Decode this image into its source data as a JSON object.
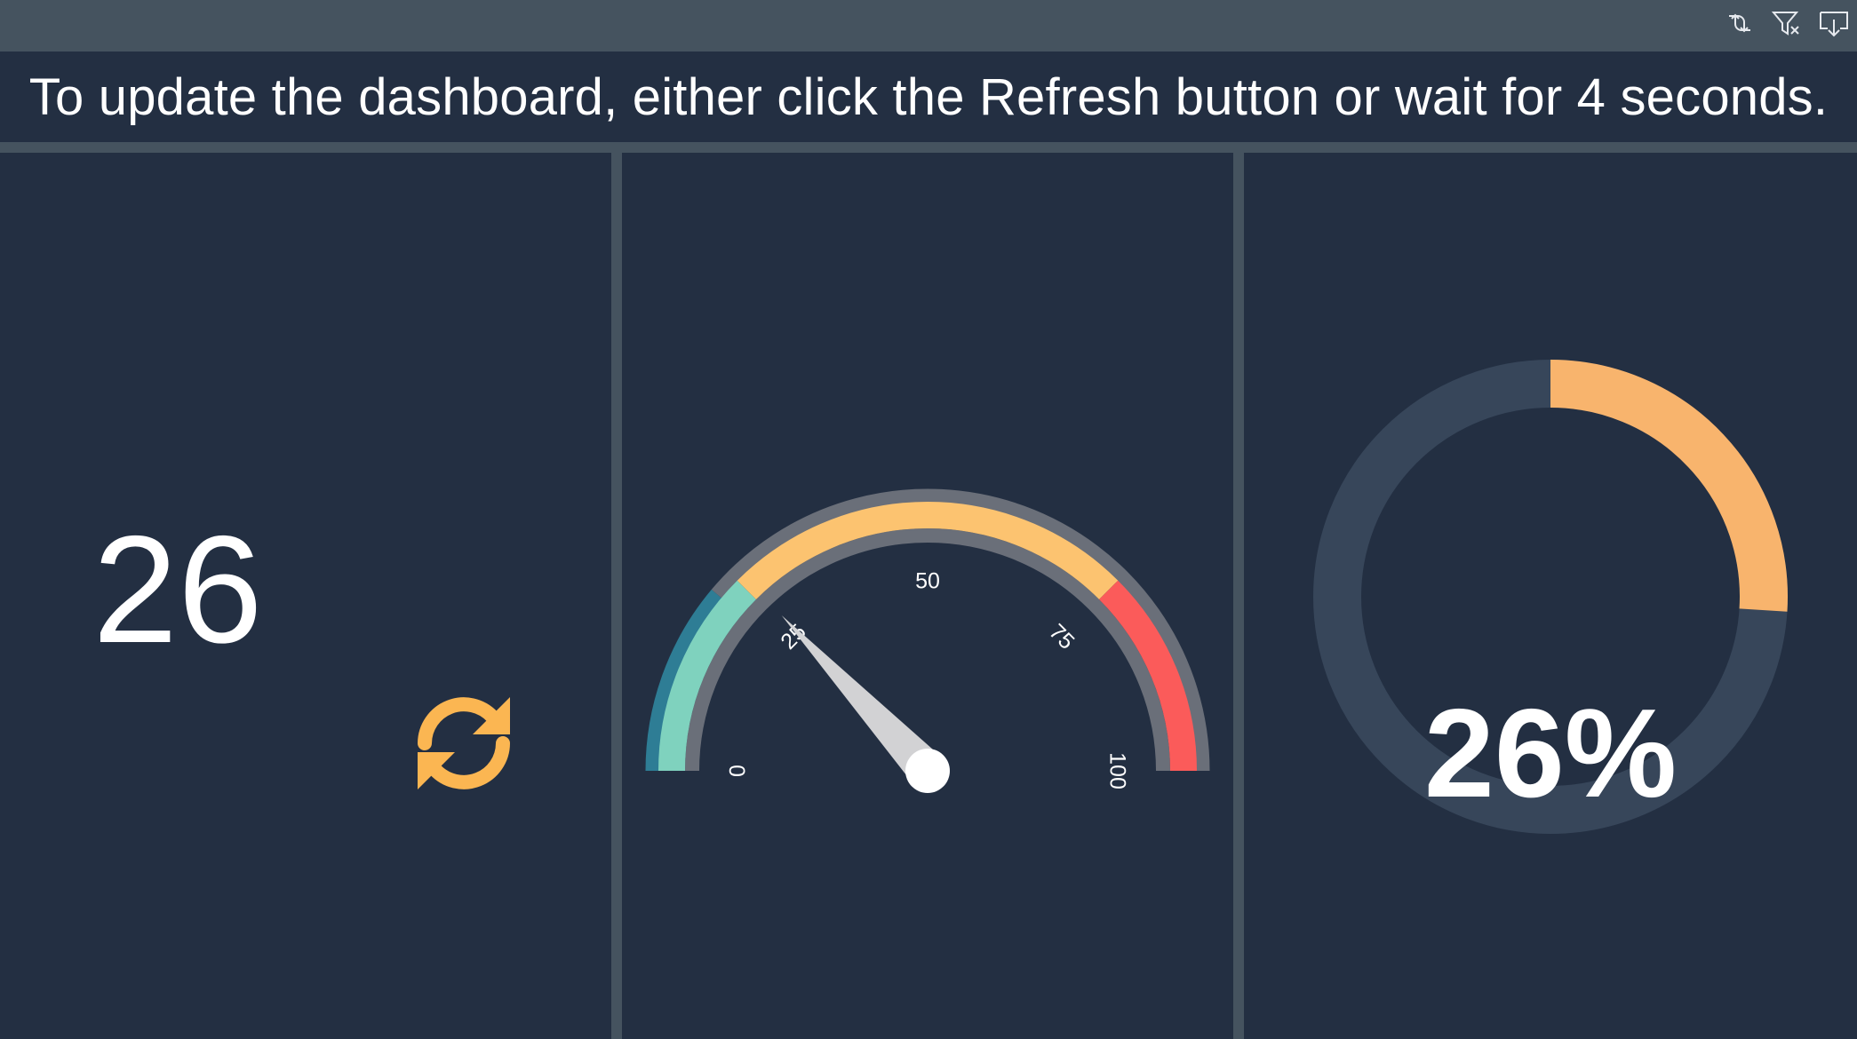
{
  "toolbar": {
    "icons": [
      "refresh-visual-icon",
      "clear-filter-icon",
      "export-icon"
    ]
  },
  "banner": {
    "text": "To update the dashboard, either click the Refresh button or wait for 4 seconds."
  },
  "kpi": {
    "value": "26",
    "icon": "refresh-icon",
    "icon_color": "#fbb652"
  },
  "gauge": {
    "value": 26,
    "min": 0,
    "max": 100,
    "tick_labels": [
      "0",
      "25",
      "50",
      "75",
      "100"
    ],
    "bands": [
      {
        "from": 0,
        "to": 25,
        "color": "#7fd2be"
      },
      {
        "from": 25,
        "to": 75,
        "color": "#fcc370"
      },
      {
        "from": 75,
        "to": 100,
        "color": "#fb5b5a"
      }
    ],
    "outer_colors": [
      "#2e7d95",
      "#6a6f79"
    ],
    "needle_color": "#d2d2d4"
  },
  "donut": {
    "percent": 26,
    "label": "26%",
    "fill_color": "#f8b46d",
    "track_color": "#37465a"
  },
  "colors": {
    "panel_bg": "#232f42",
    "frame_bg": "#45535f",
    "text": "#ffffff"
  }
}
